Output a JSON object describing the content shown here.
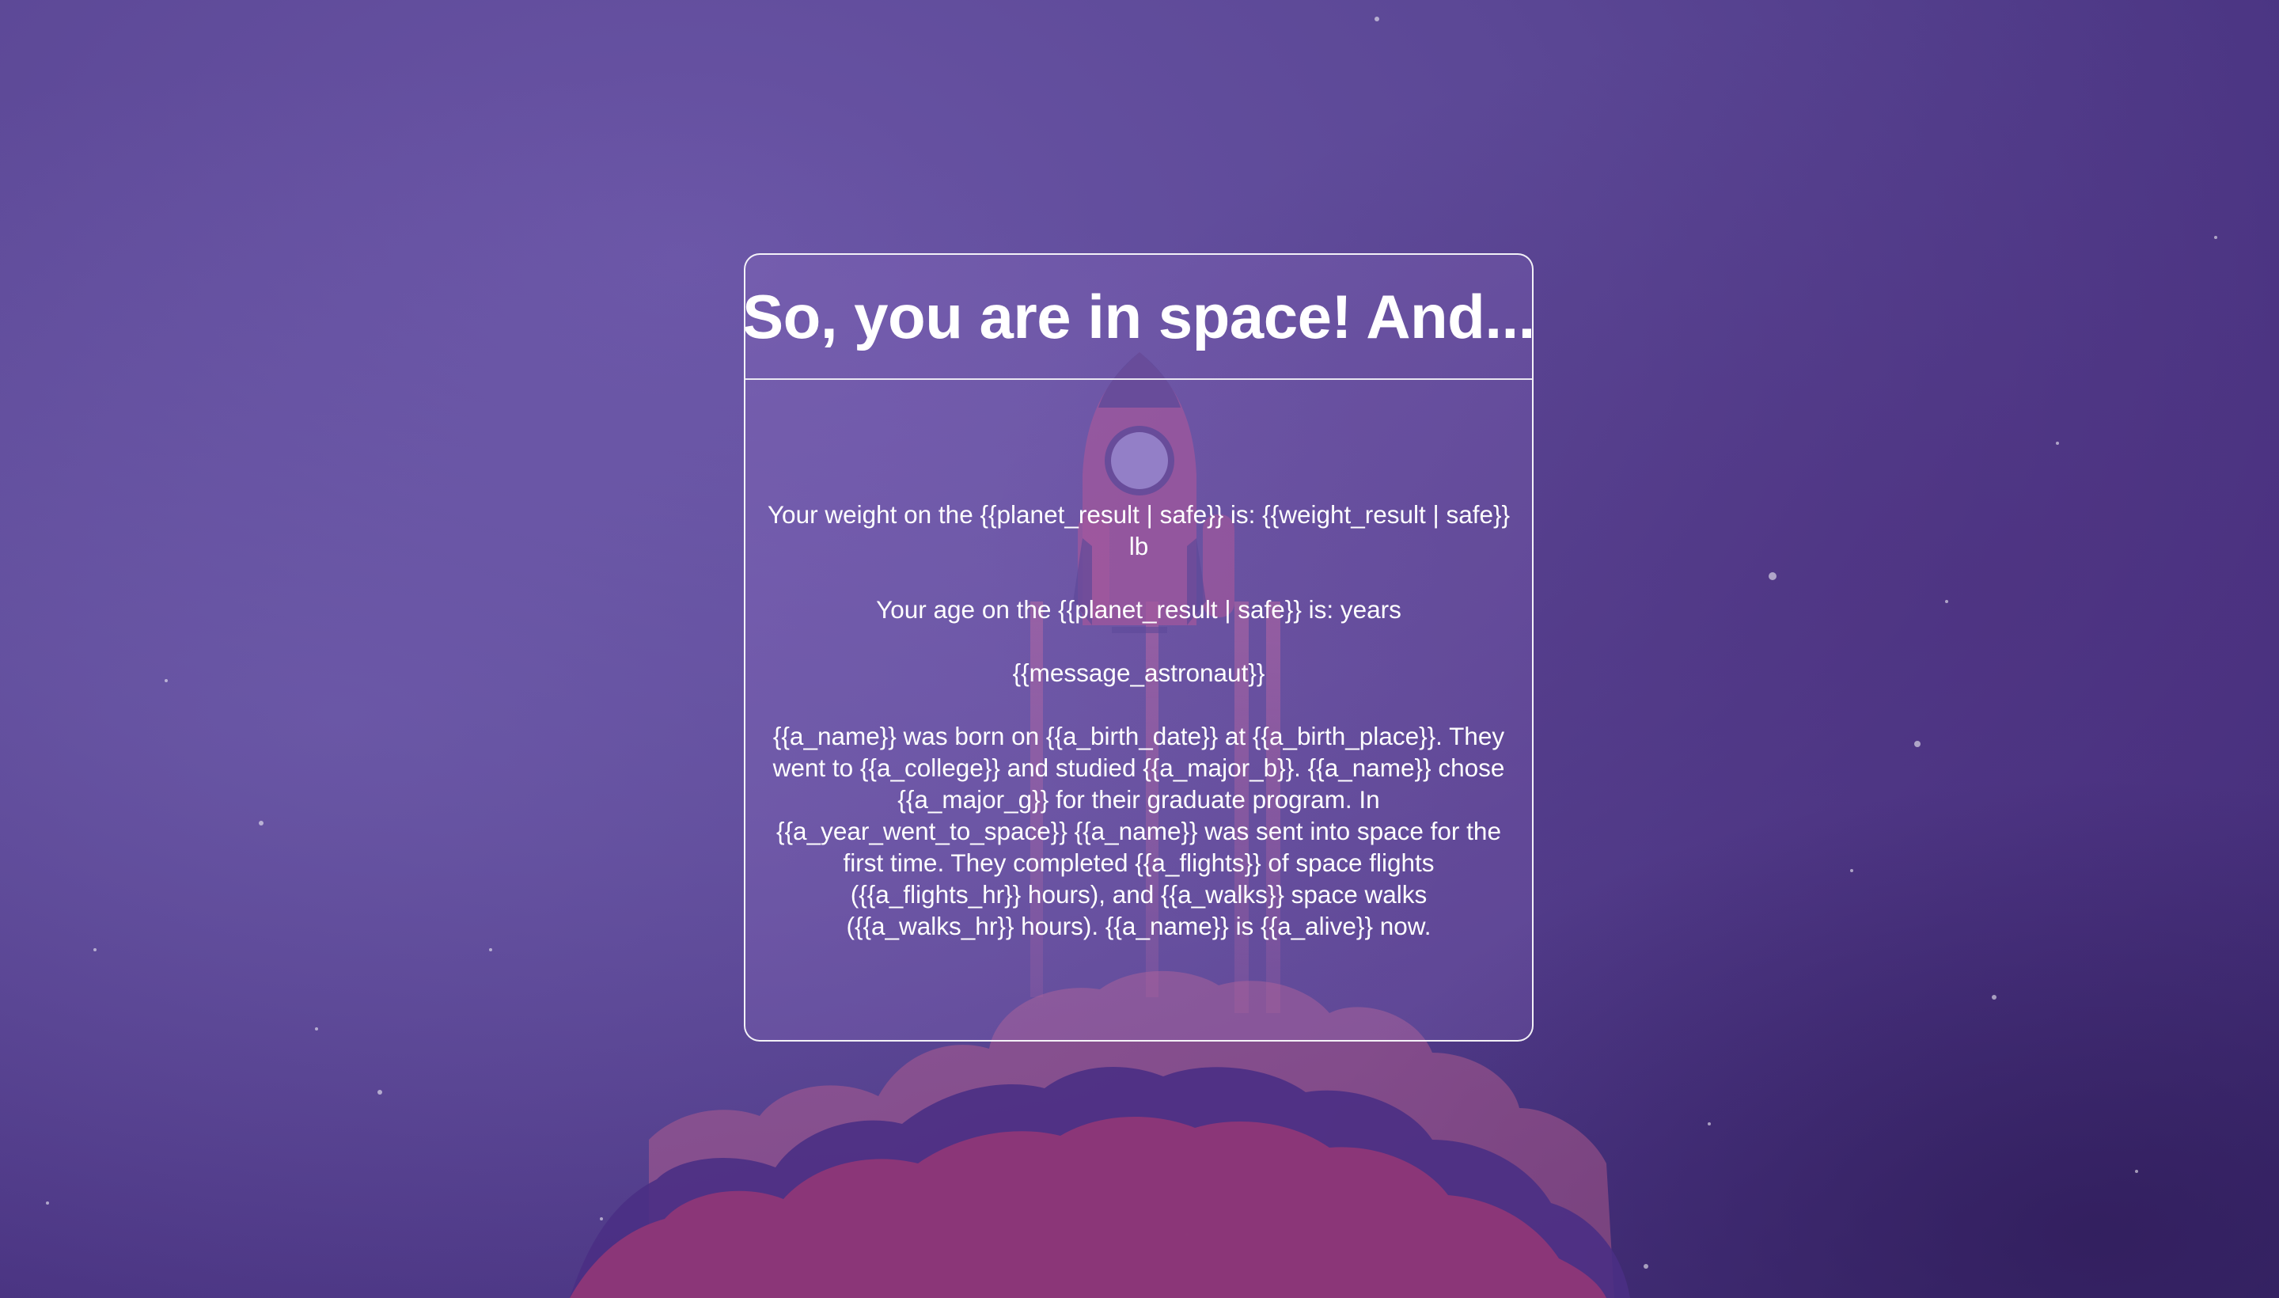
{
  "page": {
    "title": "So, you are in space! And...",
    "weight_line": "Your weight on the {{planet_result | safe}} is: {{weight_result | safe}} lb",
    "age_line": "Your age on the {{planet_result | safe}} is: years",
    "message": "{{message_astronaut}}",
    "bio": "{{a_name}} was born on {{a_birth_date}} at {{a_birth_place}}. They went to {{a_college}} and studied {{a_major_b}}. {{a_name}} chose {{a_major_g}} for their graduate program. In {{a_year_went_to_space}} {{a_name}} was sent into space for the first time. They completed {{a_flights}} of space flights ({{a_flights_hr}} hours), and {{a_walks}} space walks ({{a_walks_hr}} hours). {{a_name}} is {{a_alive}} now."
  },
  "colors": {
    "background": "#5b4795",
    "rocket_body": "#b0508f",
    "rocket_window": "#9c8ccf",
    "smoke": "#d46a9a",
    "text": "#ffffff"
  }
}
